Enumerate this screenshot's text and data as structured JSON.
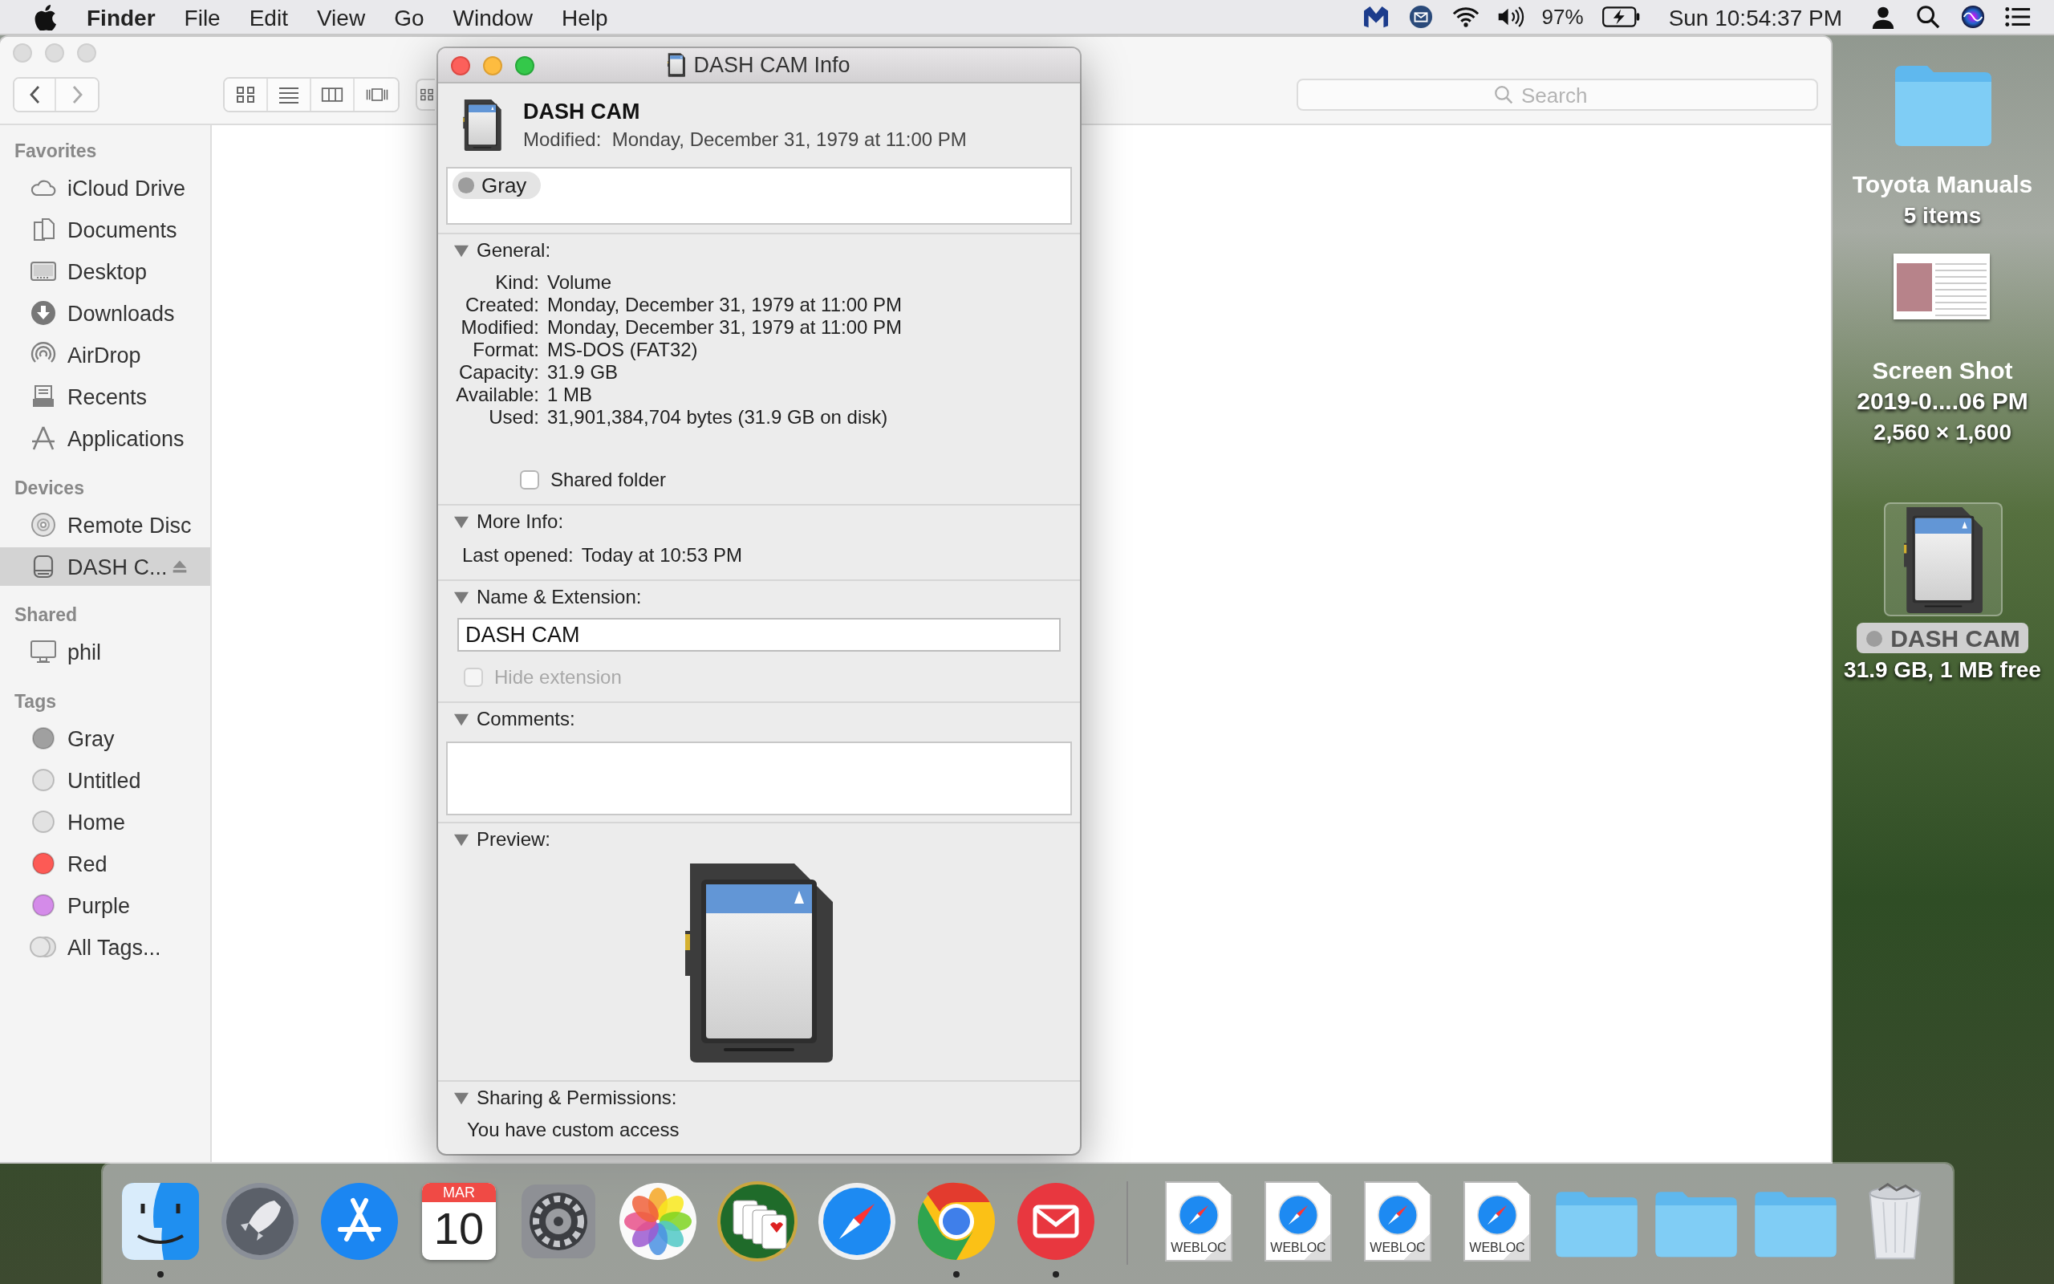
{
  "menu_bar": {
    "app_name": "Finder",
    "menus": [
      "File",
      "Edit",
      "View",
      "Go",
      "Window",
      "Help"
    ],
    "battery": "97%",
    "clock": "Sun 10:54:37 PM"
  },
  "finder_window": {
    "search": {
      "placeholder": "Search"
    },
    "sidebar": [
      {
        "title": "Favorites",
        "items": [
          {
            "label": "iCloud Drive",
            "selected": false
          },
          {
            "label": "Documents",
            "selected": false
          },
          {
            "label": "Desktop",
            "selected": false
          },
          {
            "label": "Downloads",
            "selected": false
          },
          {
            "label": "AirDrop",
            "selected": false
          },
          {
            "label": "Recents",
            "selected": false
          },
          {
            "label": "Applications",
            "selected": false
          }
        ]
      },
      {
        "title": "Devices",
        "items": [
          {
            "label": "Remote Disc",
            "selected": false,
            "eject": false
          },
          {
            "label": "DASH C...",
            "selected": true,
            "eject": true
          }
        ]
      },
      {
        "title": "Shared",
        "items": [
          {
            "label": "phil",
            "selected": false
          }
        ]
      },
      {
        "title": "Tags",
        "items": [
          {
            "label": "Gray",
            "kind": "tag",
            "color": "#a0a0a0",
            "selected": false
          },
          {
            "label": "Untitled",
            "kind": "tag",
            "color": "#e2e2e2",
            "selected": false
          },
          {
            "label": "Home",
            "kind": "tag",
            "color": "#e2e2e2",
            "selected": false
          },
          {
            "label": "Red",
            "kind": "tag",
            "color": "#fd5a55",
            "selected": false
          },
          {
            "label": "Purple",
            "kind": "tag",
            "color": "#d48be9",
            "selected": false
          },
          {
            "label": "All Tags...",
            "kind": "all",
            "selected": false
          }
        ]
      }
    ]
  },
  "info_window": {
    "title": "DASH CAM Info",
    "name": "DASH CAM",
    "modified": "Modified:  Monday, December 31, 1979 at 11:00 PM",
    "tags": [
      {
        "label": "Gray",
        "color": "#9d9d9d"
      }
    ],
    "sections": [
      {
        "kind": "general",
        "title": "General:",
        "expanded": true,
        "rows": [
          {
            "label": "Kind:",
            "value": "Volume"
          },
          {
            "label": "Created:",
            "value": "Monday, December 31, 1979 at 11:00 PM"
          },
          {
            "label": "Modified:",
            "value": "Monday, December 31, 1979 at 11:00 PM"
          },
          {
            "label": "Format:",
            "value": "MS-DOS (FAT32)"
          },
          {
            "label": "Capacity:",
            "value": "31.9 GB"
          },
          {
            "label": "Available:",
            "value": "1 MB"
          },
          {
            "label": "Used:",
            "value": "31,901,384,704 bytes (31.9 GB on disk)"
          }
        ],
        "shared_folder": {
          "label": "Shared folder",
          "checked": false
        }
      },
      {
        "kind": "more_info",
        "title": "More Info:",
        "expanded": true,
        "rows": [
          {
            "label": "Last opened:",
            "value": "Today at 10:53 PM"
          }
        ]
      },
      {
        "kind": "name",
        "title": "Name & Extension:",
        "expanded": true,
        "name_value": "DASH CAM",
        "hide_extension": {
          "label": "Hide extension",
          "checked": false,
          "disabled": true
        }
      },
      {
        "kind": "comments",
        "title": "Comments:",
        "expanded": true
      },
      {
        "kind": "preview",
        "title": "Preview:",
        "expanded": true
      },
      {
        "kind": "sharing",
        "title": "Sharing & Permissions:",
        "expanded": true,
        "text": "You have custom access"
      }
    ]
  },
  "desktop_icons": [
    {
      "kind": "folder",
      "name_lines": [
        "Toyota Manuals"
      ],
      "info": "5 items",
      "selected": false
    },
    {
      "kind": "screenshot",
      "name_lines": [
        "Screen Shot",
        "2019-0....06 PM"
      ],
      "info": "2,560 × 1,600",
      "selected": false
    },
    {
      "kind": "sdcard",
      "name_lines": [
        "DASH CAM"
      ],
      "info": "31.9 GB, 1 MB free",
      "selected": true,
      "color": "#9d9d9d"
    }
  ],
  "dock": [
    {
      "kind": "finder",
      "running": true
    },
    {
      "kind": "launchpad",
      "running": false
    },
    {
      "kind": "appstore",
      "running": false
    },
    {
      "kind": "calendar",
      "month": "MAR",
      "day": "10",
      "running": false
    },
    {
      "kind": "preferences",
      "running": false
    },
    {
      "kind": "photos",
      "running": false
    },
    {
      "kind": "solitaire",
      "running": false
    },
    {
      "kind": "safari",
      "running": false
    },
    {
      "kind": "chrome",
      "running": true
    },
    {
      "kind": "mail",
      "running": true
    },
    {
      "kind": "separator"
    },
    {
      "kind": "webloc",
      "label": "WEBLOC",
      "running": false
    },
    {
      "kind": "webloc",
      "label": "WEBLOC",
      "running": false
    },
    {
      "kind": "webloc",
      "label": "WEBLOC",
      "running": false
    },
    {
      "kind": "webloc",
      "label": "WEBLOC",
      "running": false
    },
    {
      "kind": "folder",
      "running": false
    },
    {
      "kind": "folder",
      "running": false
    },
    {
      "kind": "folder",
      "running": false
    },
    {
      "kind": "trash",
      "running": false
    }
  ]
}
